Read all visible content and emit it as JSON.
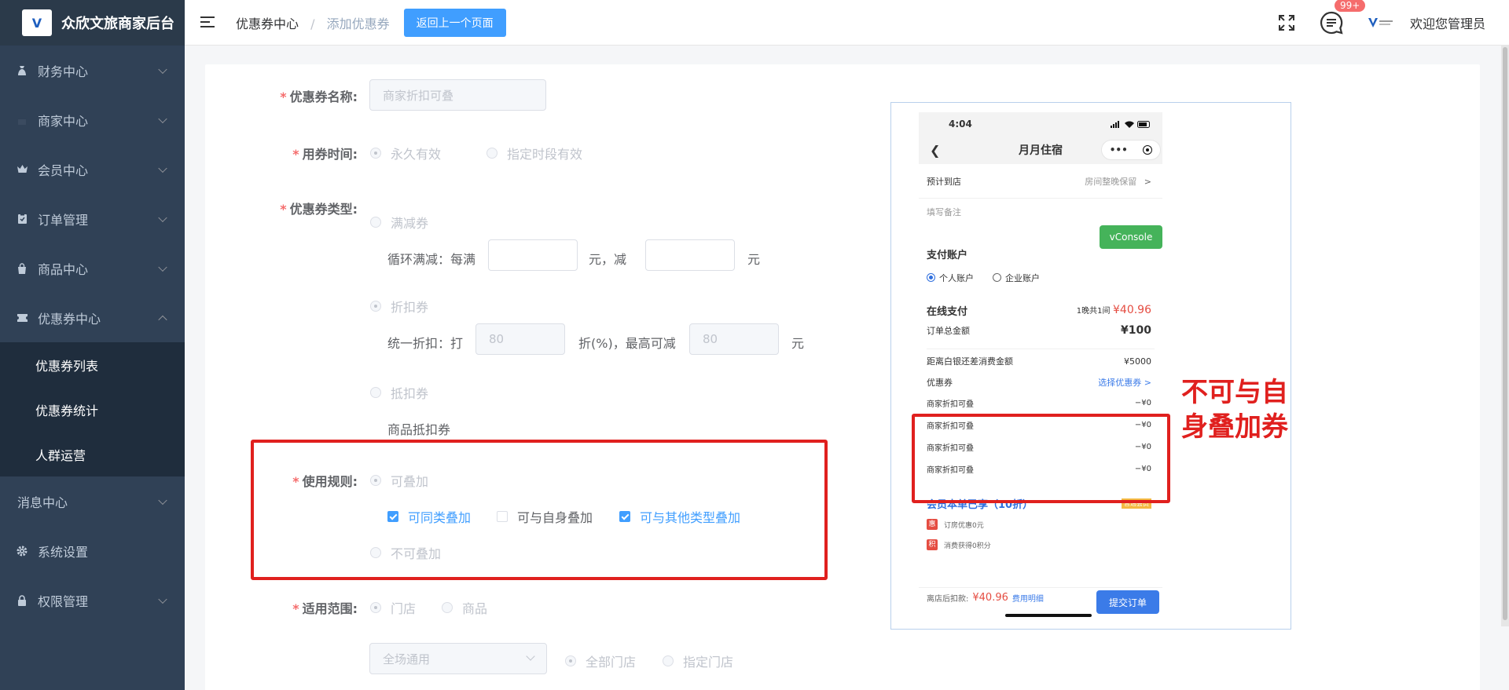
{
  "brand": {
    "logo_text": "V",
    "title": "众欣文旅商家后台"
  },
  "sidebar": {
    "items": [
      {
        "label": "财务中心",
        "icon": "money-bag-icon"
      },
      {
        "label": "商家中心",
        "icon": "shop-icon"
      },
      {
        "label": "会员中心",
        "icon": "crown-icon"
      },
      {
        "label": "订单管理",
        "icon": "clipboard-icon"
      },
      {
        "label": "商品中心",
        "icon": "bag-icon"
      },
      {
        "label": "优惠券中心",
        "icon": "ticket-icon",
        "expanded": true
      }
    ],
    "subitems": [
      "优惠券列表",
      "优惠券统计",
      "人群运营"
    ],
    "items_after": [
      {
        "label": "消息中心"
      },
      {
        "label": "系统设置",
        "icon": "gear-icon"
      },
      {
        "label": "权限管理",
        "icon": "lock-icon"
      }
    ]
  },
  "header": {
    "breadcrumb": [
      "优惠券中心",
      "添加优惠券"
    ],
    "separator": "/",
    "back_button": "返回上一个页面",
    "badge": "99+",
    "welcome": "欢迎您管理员"
  },
  "form": {
    "name_label": "优惠券名称:",
    "name_placeholder": "商家折扣可叠",
    "time_label": "用券时间:",
    "time_options": [
      "永久有效",
      "指定时段有效"
    ],
    "type_label": "优惠券类型:",
    "type_full_reduce": "满减券",
    "loop_text": "循环满减：每满",
    "yuan_reduce": "元，减",
    "yuan": "元",
    "type_discount": "折扣券",
    "discount_text": "统一折扣：打",
    "discount_value": "80",
    "discount_unit": "折(%)，最高可减",
    "max_value": "80",
    "type_deduct": "抵扣券",
    "deduct_text": "商品抵扣券",
    "rule_label": "使用规则:",
    "rule_stackable": "可叠加",
    "rule_checks": [
      {
        "label": "可同类叠加",
        "checked": true
      },
      {
        "label": "可与自身叠加",
        "checked": false
      },
      {
        "label": "可与其他类型叠加",
        "checked": true
      }
    ],
    "rule_not_stackable": "不可叠加",
    "scope_label": "适用范围:",
    "scope_options": [
      "门店",
      "商品"
    ],
    "scope_select": "全场通用",
    "store_options": [
      "全部门店",
      "指定门店"
    ]
  },
  "phone": {
    "time": "4:04",
    "title": "月月住宿",
    "capsule_more": "•••",
    "arrive_label": "预计到店",
    "arrive_value": "房间整晚保留",
    "remark": "填写备注",
    "vconsole": "vConsole",
    "pay_account": "支付账户",
    "account_options": [
      "个人账户",
      "企业账户"
    ],
    "online_pay": "在线支付",
    "nights": "1晚共1间",
    "price": "¥40.96",
    "total_label": "订单总金额",
    "total_value": "¥100",
    "gap_label": "距离白银还差消费金额",
    "gap_value": "¥5000",
    "coupon_label": "优惠券",
    "coupon_select": "选择优惠券",
    "coupons": [
      {
        "name": "商家折扣可叠",
        "value": "−¥0"
      },
      {
        "name": "商家折扣可叠",
        "value": "−¥0"
      },
      {
        "name": "商家折扣可叠",
        "value": "−¥0"
      },
      {
        "name": "商家折扣可叠",
        "value": "−¥0"
      }
    ],
    "member_title": "会员本单已享（10折）",
    "member_badge": "普通会员",
    "perk1_tag": "惠",
    "perk1": "订房优惠0元",
    "perk2_tag": "积",
    "perk2": "消费获得0积分",
    "footer_label": "离店后扣款:",
    "footer_price": "¥40.96",
    "fee_detail": "费用明细",
    "submit": "提交订单"
  },
  "annotation": "不可与自身叠加券",
  "colors": {
    "primary": "#409eff",
    "sidebar": "#304156",
    "highlight": "#e0201e"
  }
}
